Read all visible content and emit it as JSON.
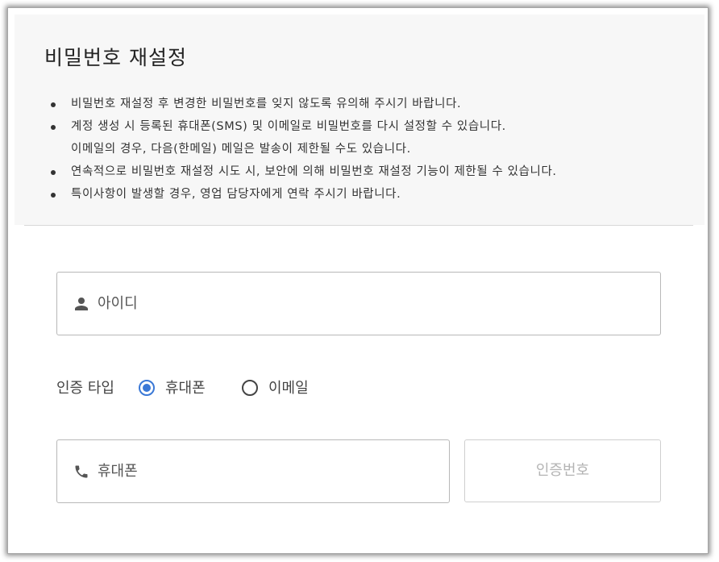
{
  "dialog": {
    "title": "비밀번호 재설정",
    "notes": [
      "비밀번호 재설정 후 변경한 비밀번호를 잊지 않도록 유의해 주시기 바랍니다.",
      "계정 생성 시 등록된 휴대폰(SMS) 및 이메일로 비밀번호를 다시 설정할 수 있습니다.",
      "이메일의 경우, 다음(한메일) 메일은 발송이 제한될 수도 있습니다.",
      "연속적으로 비밀번호 재설정 시도 시, 보안에 의해 비밀번호 재설정 기능이 제한될 수 있습니다.",
      "특이사항이 발생할 경우, 영업 담당자에게 연락 주시기 바랍니다."
    ]
  },
  "form": {
    "id_field": {
      "placeholder": "아이디",
      "icon": "person-icon"
    },
    "auth_type": {
      "label": "인증 타입",
      "options": [
        {
          "label": "휴대폰",
          "selected": true
        },
        {
          "label": "이메일",
          "selected": false
        }
      ]
    },
    "phone_field": {
      "placeholder": "휴대폰",
      "icon": "phone-icon"
    },
    "verify_button": {
      "label": "인증번호"
    }
  },
  "colors": {
    "accent": "#3a78d6",
    "header_bg": "#f7f7f7",
    "border": "#b8b8b8",
    "disabled_text": "#b4b4b4"
  }
}
